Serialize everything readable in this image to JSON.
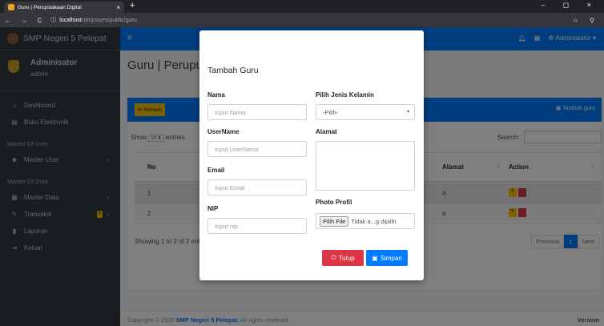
{
  "browser": {
    "tab_title": "Guru | Perupstakaan Digital",
    "tab_close": "×",
    "new_tab": "+",
    "window_controls": "– ◻ ×",
    "nav_buttons": "← → C",
    "info_icon": "ⓘ",
    "url_host": "localhost",
    "url_path": "/skripsiyes/public/guru",
    "right_icons": "☆ ⚲"
  },
  "sidebar": {
    "brand": "SMP Negeri 5 Pelepat",
    "user_name": "Adminisator",
    "user_role": "admin",
    "items": [
      {
        "icon": "home-icon",
        "glyph": "⌂",
        "label": "Dashboard"
      },
      {
        "icon": "book-icon",
        "glyph": "▤",
        "label": "Buku Elektronik"
      }
    ],
    "header_master_user": "Master Of User",
    "master_user": {
      "icon": "users-icon",
      "glyph": "☻",
      "label": "Master User",
      "arrow": "‹"
    },
    "header_master_data": "Master Of Data",
    "data_items": [
      {
        "icon": "database-icon",
        "glyph": "▦",
        "label": "Master Data",
        "arrow": "‹"
      },
      {
        "icon": "pen-icon",
        "glyph": "✎",
        "label": "Transaksi",
        "badge": "8",
        "arrow": "‹"
      },
      {
        "icon": "report-icon",
        "glyph": "▮",
        "label": "Laporan"
      },
      {
        "icon": "logout-icon",
        "glyph": "⇥",
        "label": "Keluar"
      }
    ]
  },
  "topnav": {
    "menu_glyph": "≡",
    "bell_glyph": "🔔︎",
    "grid_glyph": "▦",
    "user_label": "⚙ Administator ▾"
  },
  "content": {
    "page_title": "Guru | Perupustakaan",
    "refresh_label": "⟳ Refresh",
    "add_label": "▣ Tambah guru",
    "show_label": "Show",
    "show_value": "10 ⬍",
    "entries_label": "entries",
    "search_label": "Search:",
    "columns": {
      "no": "No",
      "alamat": "Alamat",
      "action": "Action"
    },
    "sort_glyph": "⇅",
    "rows": [
      {
        "no": "1",
        "alamat": "A"
      },
      {
        "no": "2",
        "alamat": "a"
      }
    ],
    "edit_glyph": "✎",
    "showing": "Showing 1 to 2 of 2 entries",
    "pager": {
      "previous": "Previous",
      "current": "1",
      "next": "Next"
    }
  },
  "footer": {
    "prefix": "Copyright © 2020 ",
    "school": "SMP Negeri 5 Pelepat.",
    "suffix": " All rights reserved.",
    "version": "Version"
  },
  "modal": {
    "title": "Tambah Guru",
    "nama_label": "Nama",
    "nama_placeholder": "Input Nama",
    "username_label": "UserName",
    "username_placeholder": "Input UserNama",
    "email_label": "Email",
    "email_placeholder": "Input Email",
    "nip_label": "NIP",
    "nip_placeholder": "Input nip",
    "gender_label": "Pilih Jenis Kelamin",
    "gender_value": "-Pilih-",
    "alamat_label": "Alamat",
    "photo_label": "Photo Profil",
    "file_button": "Pilih File",
    "file_status": "Tidak a...g dipilih",
    "tutup_label": "Tutup",
    "simpan_label": "Simpan",
    "power_glyph": "⏻",
    "save_glyph": "▣"
  },
  "colors": {
    "primary": "#007bff",
    "danger": "#dc3545",
    "warning": "#ffc107",
    "sidebar": "#343a40"
  }
}
